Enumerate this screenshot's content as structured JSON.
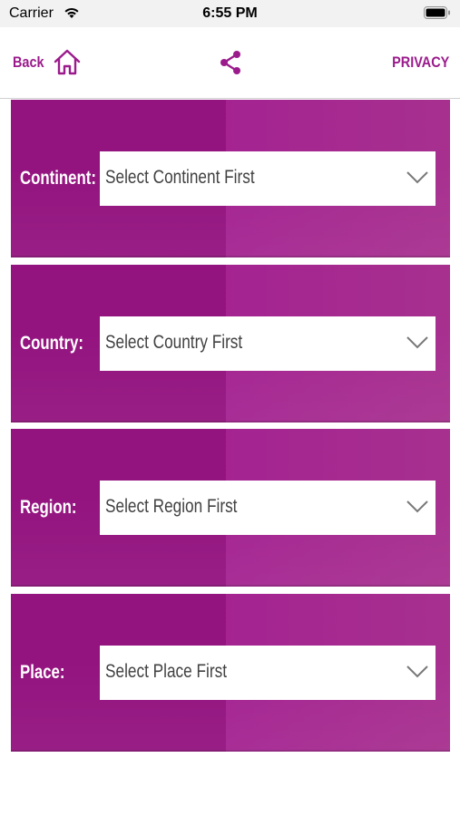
{
  "status_bar": {
    "carrier": "Carrier",
    "time": "6:55 PM"
  },
  "nav": {
    "back_label": "Back",
    "privacy_label": "PRIVACY"
  },
  "colors": {
    "accent": "#9b1b8c",
    "panel_dark": "#93137f",
    "panel_light": "#a7308f"
  },
  "selectors": [
    {
      "label": "Continent:",
      "placeholder": "Select Continent First"
    },
    {
      "label": "Country:",
      "placeholder": "Select Country First"
    },
    {
      "label": "Region:",
      "placeholder": "Select Region First"
    },
    {
      "label": "Place:",
      "placeholder": "Select Place First"
    }
  ]
}
